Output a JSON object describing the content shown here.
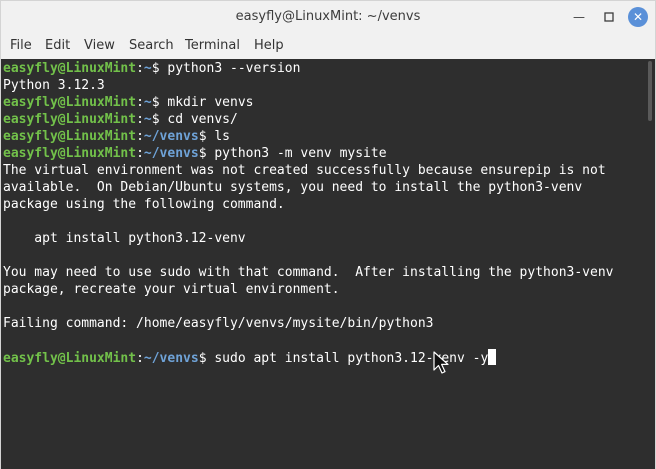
{
  "window": {
    "title": "easyfly@LinuxMint: ~/venvs"
  },
  "menubar": {
    "items": [
      "File",
      "Edit",
      "View",
      "Search",
      "Terminal",
      "Help"
    ]
  },
  "terminal": {
    "lines": [
      {
        "user": "easyfly@LinuxMint",
        "sep": ":",
        "path": "~",
        "prompt": "$ ",
        "cmd": "python3 --version"
      },
      {
        "out": "Python 3.12.3"
      },
      {
        "user": "easyfly@LinuxMint",
        "sep": ":",
        "path": "~",
        "prompt": "$ ",
        "cmd": "mkdir venvs"
      },
      {
        "user": "easyfly@LinuxMint",
        "sep": ":",
        "path": "~",
        "prompt": "$ ",
        "cmd": "cd venvs/"
      },
      {
        "user": "easyfly@LinuxMint",
        "sep": ":",
        "path": "~/venvs",
        "prompt": "$ ",
        "cmd": "ls"
      },
      {
        "user": "easyfly@LinuxMint",
        "sep": ":",
        "path": "~/venvs",
        "prompt": "$ ",
        "cmd": "python3 -m venv mysite"
      },
      {
        "out": "The virtual environment was not created successfully because ensurepip is not"
      },
      {
        "out": "available.  On Debian/Ubuntu systems, you need to install the python3-venv"
      },
      {
        "out": "package using the following command."
      },
      {
        "out": ""
      },
      {
        "out": "    apt install python3.12-venv"
      },
      {
        "out": ""
      },
      {
        "out": "You may need to use sudo with that command.  After installing the python3-venv"
      },
      {
        "out": "package, recreate your virtual environment."
      },
      {
        "out": ""
      },
      {
        "out": "Failing command: /home/easyfly/venvs/mysite/bin/python3"
      },
      {
        "out": ""
      },
      {
        "user": "easyfly@LinuxMint",
        "sep": ":",
        "path": "~/venvs",
        "prompt": "$ ",
        "cmd": "sudo apt install python3.12-venv -y"
      }
    ]
  }
}
